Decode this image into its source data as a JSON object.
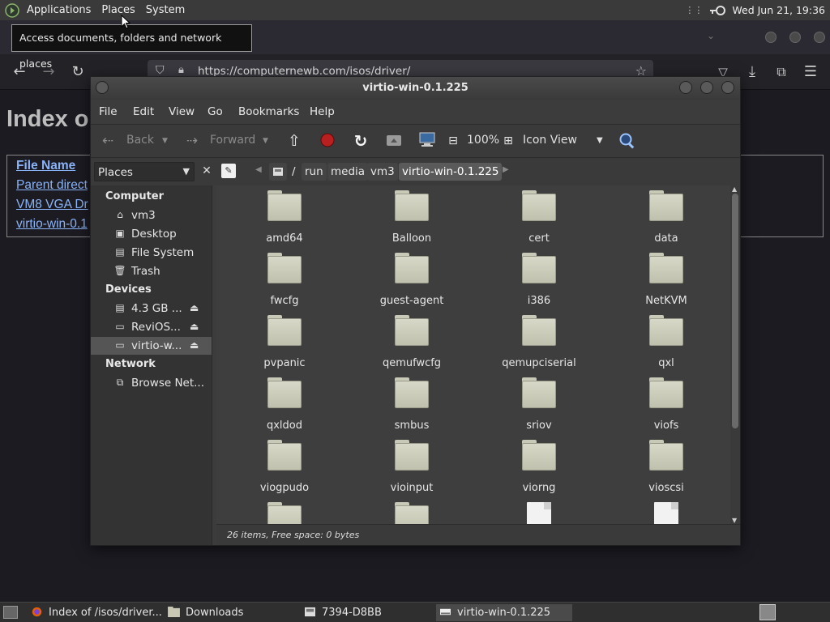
{
  "top_panel": {
    "menus": [
      "Applications",
      "Places",
      "System"
    ],
    "clock": "Wed Jun 21, 19:36"
  },
  "tooltip": "Access documents, folders and network places",
  "browser": {
    "url": "https://computernewb.com/isos/driver/",
    "heading": "Index o",
    "table_header": "File Name",
    "links": [
      "Parent direct",
      "VM8 VGA Dr",
      "virtio-win-0.1"
    ]
  },
  "file_manager": {
    "title": "virtio-win-0.1.225",
    "menus": [
      "File",
      "Edit",
      "View",
      "Go",
      "Bookmarks",
      "Help"
    ],
    "toolbar": {
      "back": "Back",
      "forward": "Forward",
      "zoom": "100%",
      "view_mode": "Icon View"
    },
    "places_label": "Places",
    "breadcrumbs": [
      "/",
      "run",
      "media",
      "vm3",
      "virtio-win-0.1.225"
    ],
    "sidebar": {
      "computer_header": "Computer",
      "computer": [
        "vm3",
        "Desktop",
        "File System",
        "Trash"
      ],
      "devices_header": "Devices",
      "devices": [
        "4.3 GB ...",
        "ReviOS...",
        "virtio-w..."
      ],
      "network_header": "Network",
      "network": [
        "Browse Net..."
      ]
    },
    "items": [
      {
        "name": "amd64",
        "type": "folder"
      },
      {
        "name": "Balloon",
        "type": "folder"
      },
      {
        "name": "cert",
        "type": "folder"
      },
      {
        "name": "data",
        "type": "folder"
      },
      {
        "name": "fwcfg",
        "type": "folder"
      },
      {
        "name": "guest-agent",
        "type": "folder"
      },
      {
        "name": "i386",
        "type": "folder"
      },
      {
        "name": "NetKVM",
        "type": "folder"
      },
      {
        "name": "pvpanic",
        "type": "folder"
      },
      {
        "name": "qemufwcfg",
        "type": "folder"
      },
      {
        "name": "qemupciserial",
        "type": "folder"
      },
      {
        "name": "qxl",
        "type": "folder"
      },
      {
        "name": "qxldod",
        "type": "folder"
      },
      {
        "name": "smbus",
        "type": "folder"
      },
      {
        "name": "sriov",
        "type": "folder"
      },
      {
        "name": "viofs",
        "type": "folder"
      },
      {
        "name": "viogpudo",
        "type": "folder"
      },
      {
        "name": "vioinput",
        "type": "folder"
      },
      {
        "name": "viorng",
        "type": "folder"
      },
      {
        "name": "vioscsi",
        "type": "folder"
      },
      {
        "name": "",
        "type": "folder"
      },
      {
        "name": "",
        "type": "folder"
      },
      {
        "name": "",
        "type": "file"
      },
      {
        "name": "",
        "type": "file"
      }
    ],
    "status": "26 items, Free space: 0 bytes"
  },
  "taskbar": {
    "tasks": [
      "Index of /isos/driver...",
      "Downloads",
      "7394-D8BB",
      "virtio-win-0.1.225"
    ]
  }
}
